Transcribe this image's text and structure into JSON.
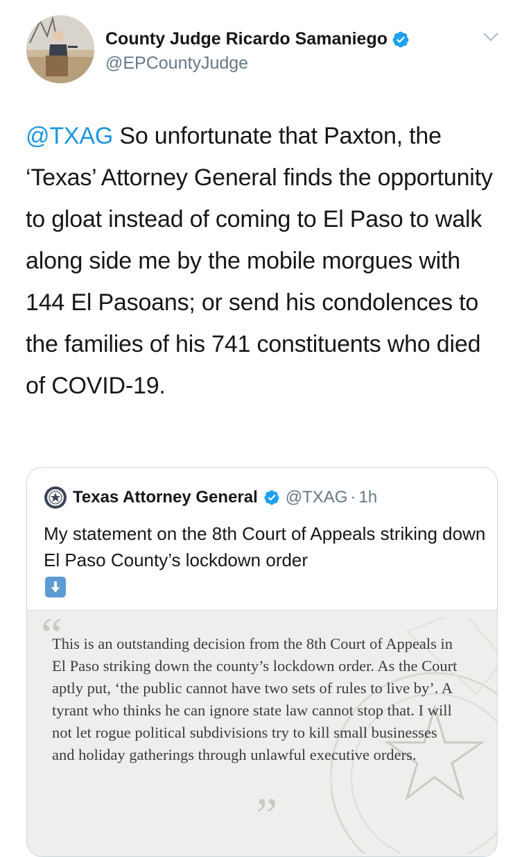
{
  "tweet": {
    "author_name": "County Judge Ricardo Samaniego",
    "author_handle": "@EPCountyJudge",
    "mention": "@TXAG",
    "body": " So unfortunate that Paxton, the ‘Texas’ Attorney General finds the opportunity to gloat instead of coming to El Paso to walk along side me by the mobile morgues with 144 El Pasoans; or send his condolences to the families of his 741 constituents who died of COVID-19."
  },
  "quoted": {
    "author_name": "Texas Attorney General",
    "author_handle": "@TXAG",
    "separator": "·",
    "time": "1h",
    "text": "My statement on the 8th Court of Appeals striking down El Paso County’s lockdown order",
    "emoji": "down-arrow-button",
    "statement": "This is an outstanding decision from the 8th Court of Appeals in El Paso striking down the county’s lockdown order. As the Court aptly put, ‘the public cannot have two sets of rules to live by’. A tyrant who thinks he can ignore state law cannot stop that. I will not let rogue political subdivisions try to kill small businesses and holiday gatherings through unlawful executive orders."
  },
  "icons": {
    "verified": "verified-badge-icon",
    "more": "chevron-down-icon"
  },
  "colors": {
    "link": "#1b95e0",
    "secondary_text": "#657786",
    "verified": "#1da1f2",
    "border": "#ccd6dd"
  }
}
